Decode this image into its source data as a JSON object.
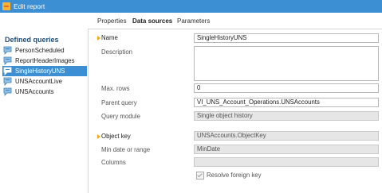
{
  "window": {
    "title": "Edit report"
  },
  "tabs": [
    "Properties",
    "Data sources",
    "Parameters"
  ],
  "left_pane": {
    "title": "Defined queries",
    "items": [
      {
        "label": "PersonScheduled",
        "selected": false
      },
      {
        "label": "ReportHeaderImages",
        "selected": false
      },
      {
        "label": "SingleHistoryUNS",
        "selected": true
      },
      {
        "label": "UNSAccountLive",
        "selected": false
      },
      {
        "label": "UNSAccounts",
        "selected": false
      }
    ]
  },
  "form": {
    "name": {
      "label": "Name",
      "value": "SingleHistoryUNS"
    },
    "description": {
      "label": "Description",
      "value": ""
    },
    "max_rows": {
      "label": "Max. rows",
      "value": "0"
    },
    "parent_query": {
      "label": "Parent query",
      "value": "VI_UNS_Account_Operations.UNSAccounts"
    },
    "query_module": {
      "label": "Query module",
      "value": "Single object history"
    },
    "object_key": {
      "label": "Object key",
      "value": "UNSAccounts.ObjectKey"
    },
    "min_date": {
      "label": "Min date or range",
      "value": "MinDate"
    },
    "columns": {
      "label": "Columns",
      "value": ""
    },
    "resolve_fk": {
      "label": "Resolve foreign key",
      "checked": true
    }
  },
  "colors": {
    "titlebar": "#3c8fd2",
    "selection": "#3c8fd2",
    "required_marker": "#f2a818"
  }
}
